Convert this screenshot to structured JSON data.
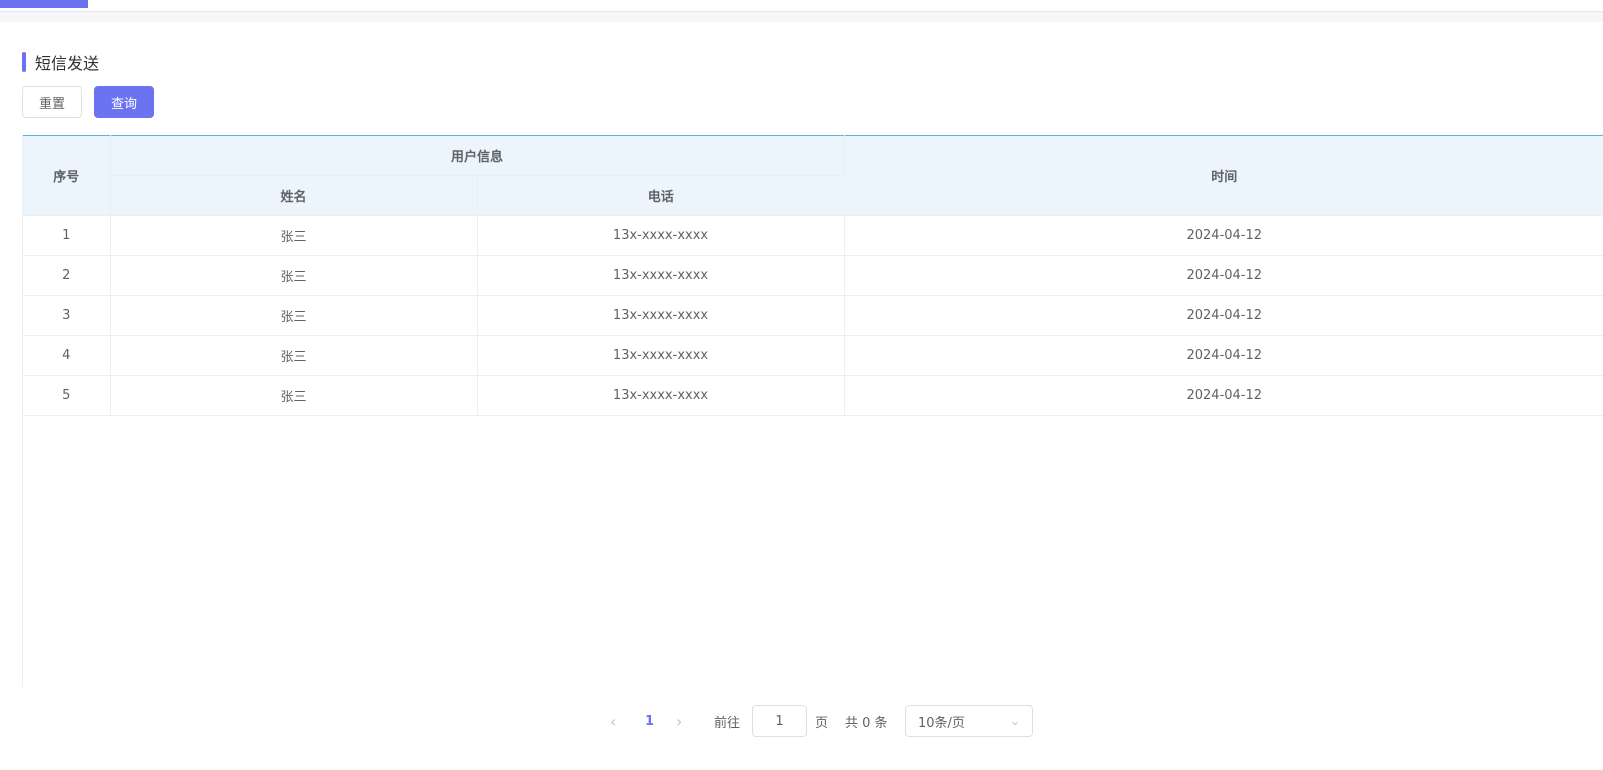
{
  "header": {
    "tab_label": ""
  },
  "section": {
    "title": "短信发送"
  },
  "toolbar": {
    "reset_label": "重置",
    "query_label": "查询"
  },
  "table": {
    "headers": {
      "index": "序号",
      "group": "用户信息",
      "name": "姓名",
      "phone": "电话",
      "time": "时间"
    },
    "rows": [
      {
        "index": "1",
        "name": "张三",
        "phone": "13x-xxxx-xxxx",
        "time": "2024-04-12"
      },
      {
        "index": "2",
        "name": "张三",
        "phone": "13x-xxxx-xxxx",
        "time": "2024-04-12"
      },
      {
        "index": "3",
        "name": "张三",
        "phone": "13x-xxxx-xxxx",
        "time": "2024-04-12"
      },
      {
        "index": "4",
        "name": "张三",
        "phone": "13x-xxxx-xxxx",
        "time": "2024-04-12"
      },
      {
        "index": "5",
        "name": "张三",
        "phone": "13x-xxxx-xxxx",
        "time": "2024-04-12"
      }
    ]
  },
  "pagination": {
    "current_page": "1",
    "goto_label": "前往",
    "goto_value": "1",
    "page_unit": "页",
    "total_label": "共 0 条",
    "page_size": "10条/页"
  },
  "colors": {
    "accent": "#6b73f0",
    "header_bg": "#ecf5fc"
  },
  "icons": {
    "prev": "chevron-left-icon",
    "next": "chevron-right-icon",
    "dropdown": "chevron-down-icon"
  }
}
